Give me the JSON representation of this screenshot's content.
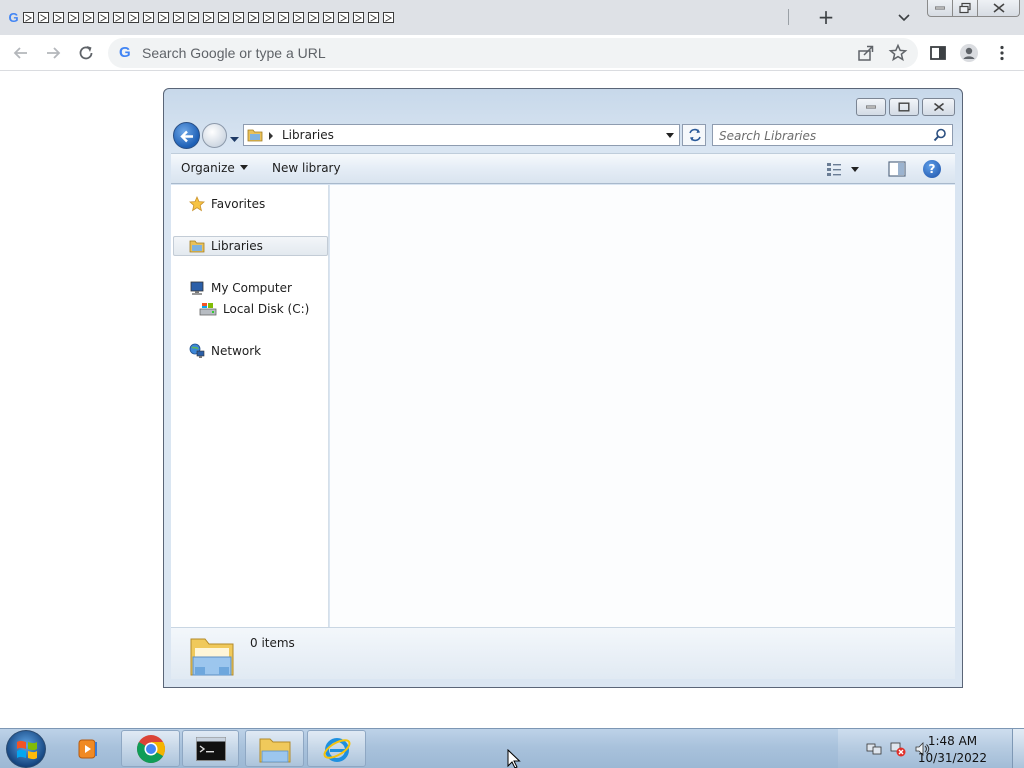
{
  "browser": {
    "tab_count": 26,
    "new_tab_label": "+",
    "omnibox": {
      "placeholder": "Search Google or type a URL",
      "google_glyph": "G"
    }
  },
  "explorer": {
    "address": {
      "location": "Libraries"
    },
    "search": {
      "placeholder": "Search Libraries"
    },
    "command_bar": {
      "organize_label": "Organize",
      "new_library_label": "New library",
      "help_label": "?"
    },
    "nav_pane": {
      "favorites": "Favorites",
      "libraries": "Libraries",
      "computer": "My Computer",
      "local_disk": "Local Disk (C:)",
      "network": "Network"
    },
    "details": {
      "item_count": "0 items"
    }
  },
  "taskbar": {
    "clock": {
      "time": "1:48 AM",
      "date": "10/31/2022"
    },
    "apps": [
      "media-player",
      "chrome",
      "command-prompt",
      "windows-explorer",
      "internet-explorer"
    ]
  },
  "colors": {
    "chrome_tabstrip": "#dee1e6",
    "google_blue": "#4285f4",
    "explorer_frame": "#c7d8ea",
    "taskbar": "#a9c2dc"
  }
}
